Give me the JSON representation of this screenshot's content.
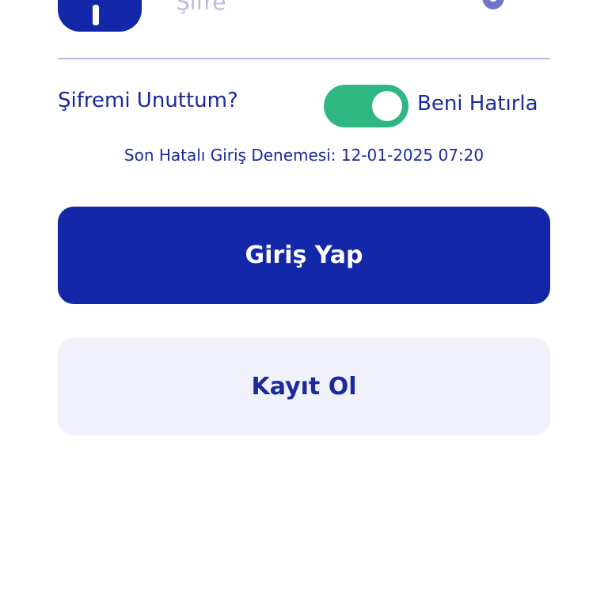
{
  "password_field": {
    "placeholder": "Şifre",
    "leading_icon": "key-icon",
    "trailing_icon": "eye-icon"
  },
  "options": {
    "forgot_password": "Şifremi Unuttum?",
    "remember_me_label": "Beni Hatırla",
    "remember_me_on": true
  },
  "last_failed_login": "Son Hatalı Giriş Denemesi: 12-01-2025 07:20",
  "buttons": {
    "login": "Giriş Yap",
    "register": "Kayıt Ol"
  },
  "colors": {
    "primary": "#1328a8",
    "toggle_on": "#2fb783",
    "secondary_bg": "#f0f1fa"
  }
}
